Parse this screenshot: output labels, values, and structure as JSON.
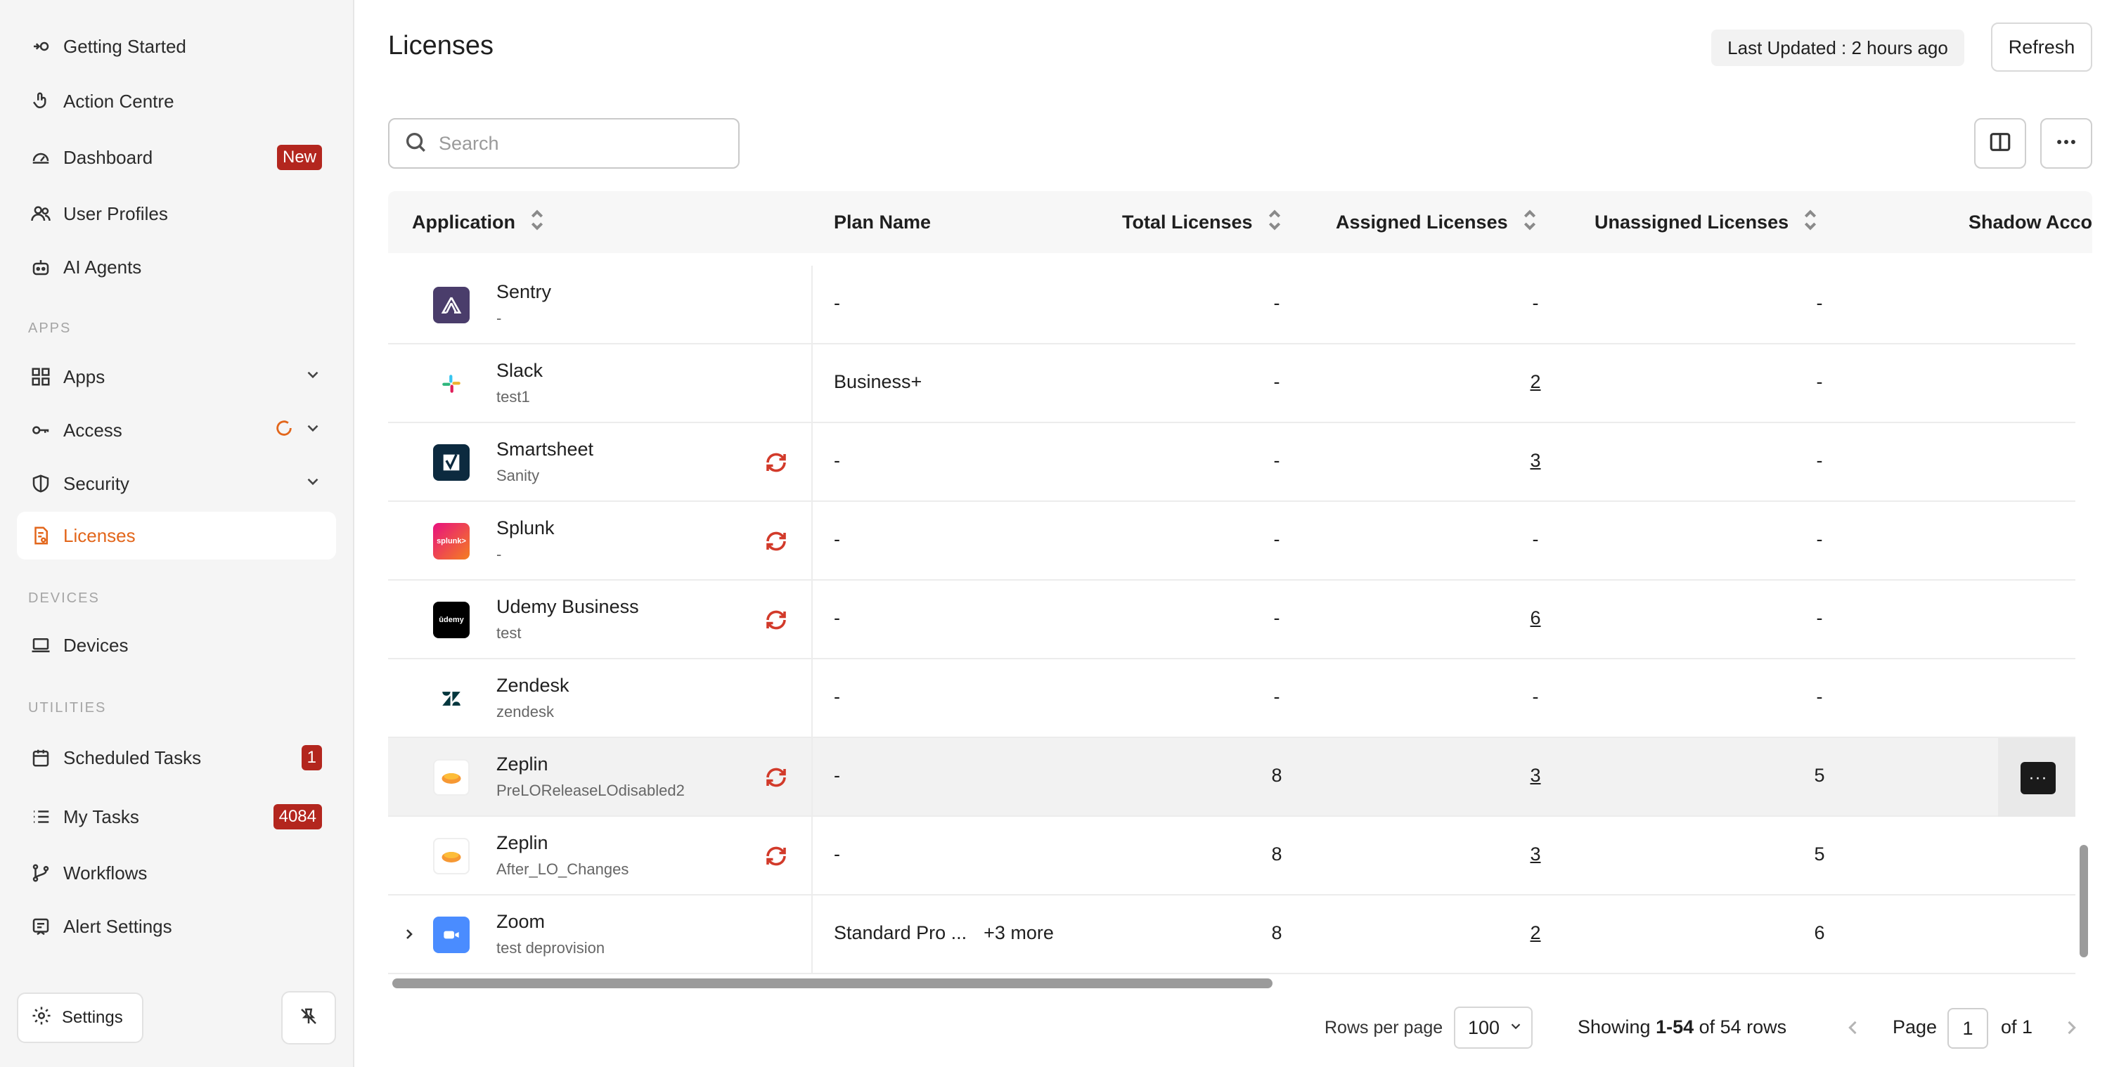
{
  "sidebar": {
    "items_top": [
      {
        "label": "Getting Started",
        "icon": "rocket-icon"
      },
      {
        "label": "Action Centre",
        "icon": "pointer-icon"
      },
      {
        "label": "Dashboard",
        "icon": "gauge-icon",
        "badge": "New"
      },
      {
        "label": "User Profiles",
        "icon": "users-icon"
      },
      {
        "label": "AI Agents",
        "icon": "robot-icon"
      }
    ],
    "section_apps": "APPS",
    "items_apps": [
      {
        "label": "Apps",
        "icon": "grid-icon"
      },
      {
        "label": "Access",
        "icon": "key-icon"
      },
      {
        "label": "Security",
        "icon": "shield-icon"
      },
      {
        "label": "Licenses",
        "icon": "license-icon",
        "active": true
      }
    ],
    "section_devices": "DEVICES",
    "items_devices": [
      {
        "label": "Devices",
        "icon": "laptop-icon"
      }
    ],
    "section_utilities": "UTILITIES",
    "items_utilities": [
      {
        "label": "Scheduled Tasks",
        "icon": "calendar-icon",
        "badge": "1"
      },
      {
        "label": "My Tasks",
        "icon": "list-icon",
        "badge": "4084"
      },
      {
        "label": "Workflows",
        "icon": "branch-icon"
      },
      {
        "label": "Alert Settings",
        "icon": "alert-icon"
      }
    ],
    "settings_label": "Settings"
  },
  "header": {
    "title": "Licenses",
    "last_updated": "Last Updated : 2 hours ago",
    "refresh_label": "Refresh"
  },
  "search": {
    "placeholder": "Search",
    "value": ""
  },
  "table": {
    "columns": [
      "Application",
      "Plan Name",
      "Total Licenses",
      "Assigned Licenses",
      "Unassigned Licenses",
      "Shadow Acco"
    ],
    "rows": [
      {
        "app": "Sentry",
        "sub": "-",
        "logo": "sentry-logo",
        "sync": false,
        "plan": "-",
        "total": "-",
        "assigned": "-",
        "assigned_link": false,
        "unassigned": "-"
      },
      {
        "app": "Slack",
        "sub": "test1",
        "logo": "slack-logo",
        "sync": false,
        "plan": "Business+",
        "total": "-",
        "assigned": "2",
        "assigned_link": true,
        "unassigned": "-"
      },
      {
        "app": "Smartsheet",
        "sub": "Sanity",
        "logo": "smartsheet-logo",
        "sync": true,
        "plan": "-",
        "total": "-",
        "assigned": "3",
        "assigned_link": true,
        "unassigned": "-"
      },
      {
        "app": "Splunk",
        "sub": "-",
        "logo": "splunk-logo",
        "sync": true,
        "plan": "-",
        "total": "-",
        "assigned": "-",
        "assigned_link": false,
        "unassigned": "-"
      },
      {
        "app": "Udemy Business",
        "sub": "test",
        "logo": "udemy-logo",
        "sync": true,
        "plan": "-",
        "total": "-",
        "assigned": "6",
        "assigned_link": true,
        "unassigned": "-"
      },
      {
        "app": "Zendesk",
        "sub": "zendesk",
        "logo": "zendesk-logo",
        "sync": false,
        "plan": "-",
        "total": "-",
        "assigned": "-",
        "assigned_link": false,
        "unassigned": "-"
      },
      {
        "app": "Zeplin",
        "sub": "PreLOReleaseLOdisabled2",
        "logo": "zeplin-logo",
        "sync": true,
        "plan": "-",
        "total": "8",
        "assigned": "3",
        "assigned_link": true,
        "unassigned": "5",
        "highlight": true
      },
      {
        "app": "Zeplin",
        "sub": "After_LO_Changes",
        "logo": "zeplin-logo",
        "sync": true,
        "plan": "-",
        "total": "8",
        "assigned": "3",
        "assigned_link": true,
        "unassigned": "5"
      },
      {
        "app": "Zoom",
        "sub": "test deprovision",
        "logo": "zoom-logo",
        "sync": false,
        "plan": "Standard Pro ...",
        "plan_more": "+3 more",
        "total": "8",
        "assigned": "2",
        "assigned_link": true,
        "unassigned": "6",
        "expandable": true
      }
    ]
  },
  "pagination": {
    "rows_per_page_label": "Rows per page",
    "rows_per_page": "100",
    "showing_prefix": "Showing ",
    "showing_range": "1-54",
    "showing_suffix": " of 54 rows",
    "page_label": "Page",
    "page": "1",
    "of_label": "of 1"
  },
  "colors": {
    "accent": "#e2661b",
    "badge": "#b3261e",
    "sync": "#d23a2a"
  }
}
